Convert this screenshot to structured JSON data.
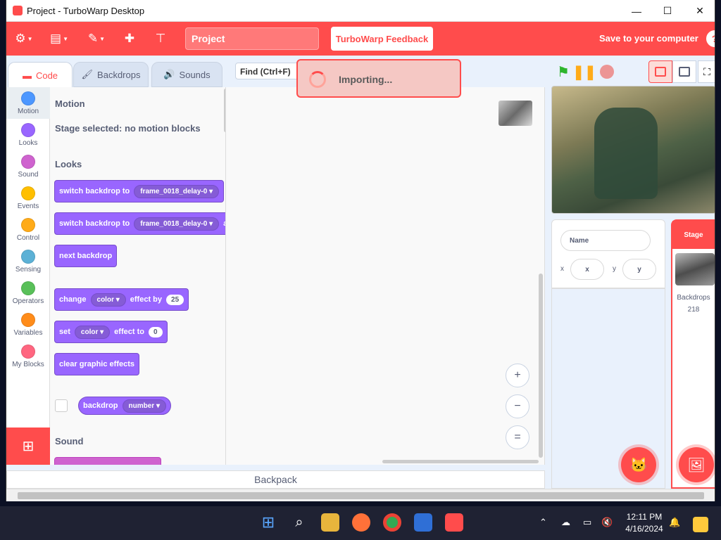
{
  "window": {
    "title": "Project - TurboWarp Desktop",
    "minimize": "—",
    "maximize": "☐",
    "close": "✕"
  },
  "menubar": {
    "project_title": "Project",
    "feedback_label": "TurboWarp Feedback",
    "save_label": "Save to your computer",
    "help": "?"
  },
  "tabs": [
    {
      "label": "Code"
    },
    {
      "label": "Backdrops"
    },
    {
      "label": "Sounds"
    }
  ],
  "find_label": "Find (Ctrl+F)",
  "importing_label": "Importing...",
  "categories": [
    {
      "label": "Motion",
      "color": "#4c97ff"
    },
    {
      "label": "Looks",
      "color": "#9966ff"
    },
    {
      "label": "Sound",
      "color": "#cf63cf"
    },
    {
      "label": "Events",
      "color": "#ffbf00"
    },
    {
      "label": "Control",
      "color": "#ffab19"
    },
    {
      "label": "Sensing",
      "color": "#5cb1d6"
    },
    {
      "label": "Operators",
      "color": "#59c059"
    },
    {
      "label": "Variables",
      "color": "#ff8c1a"
    },
    {
      "label": "My Blocks",
      "color": "#ff6680"
    }
  ],
  "palette": {
    "motion_title": "Motion",
    "motion_note": "Stage selected: no motion blocks",
    "looks_title": "Looks",
    "switch_backdrop": "switch backdrop to",
    "backdrop_value": "frame_0018_delay-0",
    "switch_backdrop_wait_suffix": "a",
    "next_backdrop": "next backdrop",
    "change": "change",
    "effect_color": "color",
    "effect_by": "effect by",
    "effect_by_value": "25",
    "set": "set",
    "effect_to": "effect to",
    "effect_to_value": "0",
    "clear_effects": "clear graphic effects",
    "backdrop_reporter": "backdrop",
    "backdrop_reporter_value": "number",
    "sound_title": "Sound"
  },
  "zoom": {
    "in": "+",
    "out": "−",
    "reset": "="
  },
  "backpack_label": "Backpack",
  "sprite_info": {
    "name_placeholder": "Name",
    "x_label": "x",
    "x_placeholder": "x",
    "y_label": "y",
    "y_placeholder": "y"
  },
  "stage_panel": {
    "header": "Stage",
    "backdrops_label": "Backdrops",
    "backdrops_count": "218"
  },
  "taskbar": {
    "time": "12:11 PM",
    "date": "4/16/2024"
  }
}
